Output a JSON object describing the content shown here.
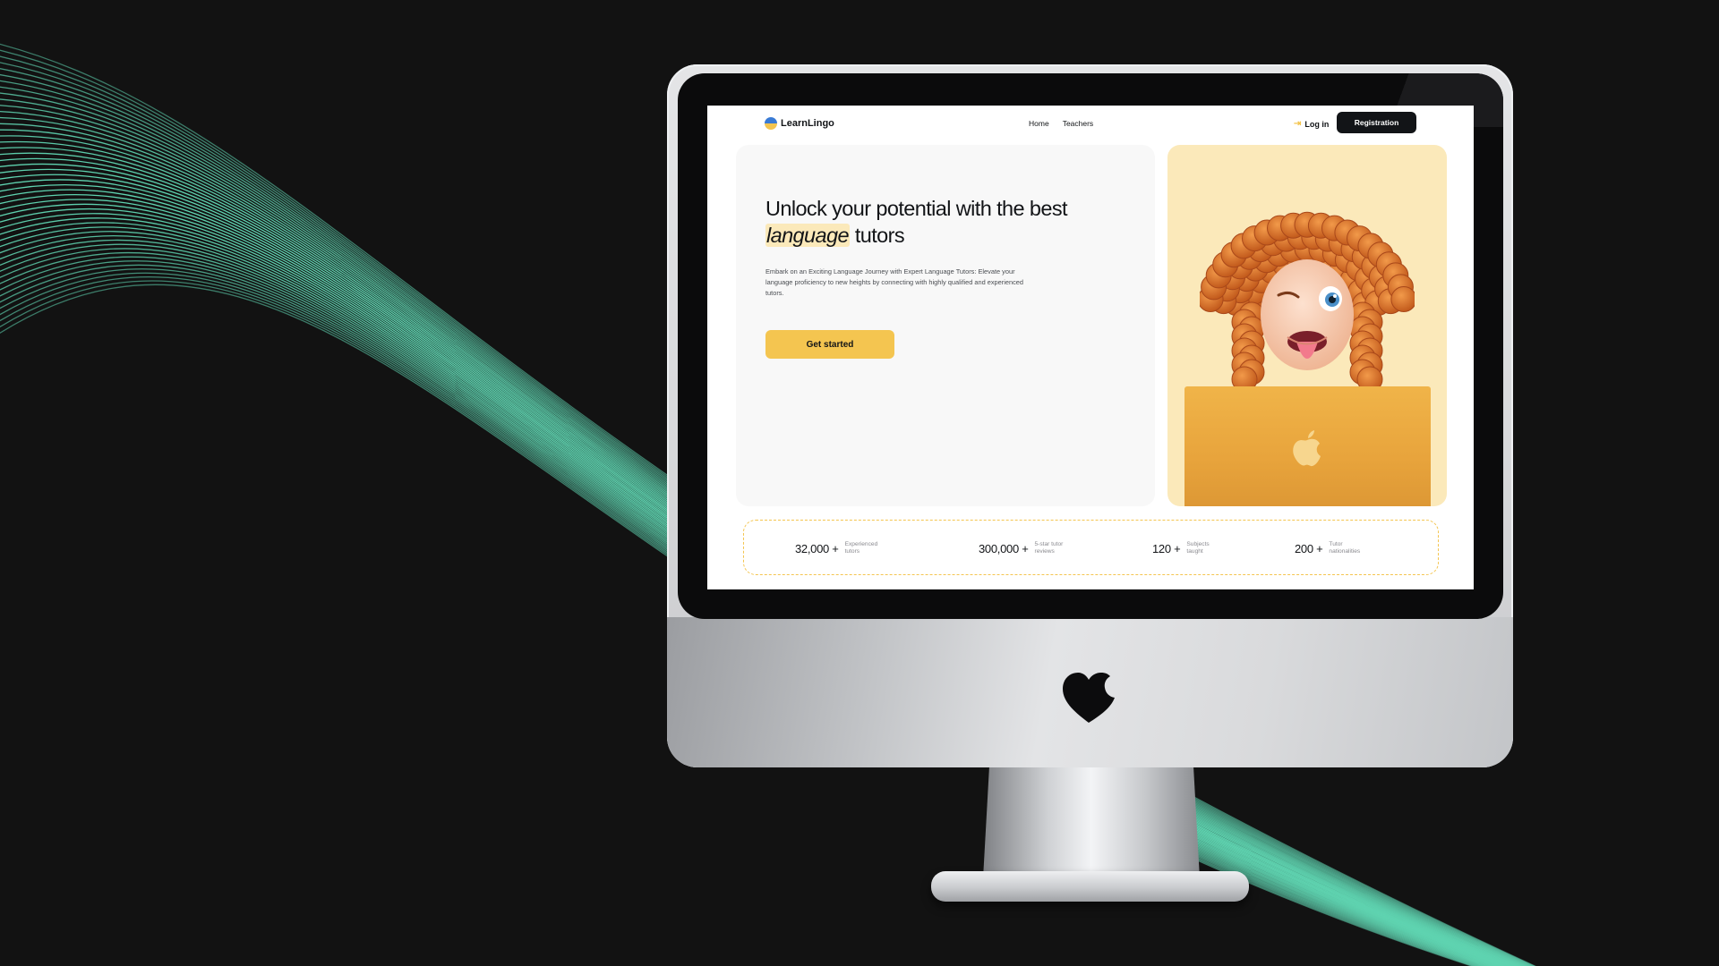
{
  "brand": {
    "name": "LearnLingo"
  },
  "nav": {
    "links": [
      "Home",
      "Teachers"
    ],
    "login_label": "Log in",
    "register_label": "Registration"
  },
  "hero": {
    "title_before": "Unlock your potential with the best ",
    "title_accent": "language",
    "title_after": " tutors",
    "description": "Embark on an Exciting Language Journey with Expert Language Tutors: Elevate your language proficiency to new heights by connecting with highly qualified and experienced tutors.",
    "cta_label": "Get started"
  },
  "stats": [
    {
      "value": "32,000 +",
      "label": "Experienced tutors"
    },
    {
      "value": "300,000 +",
      "label": "5-star tutor reviews"
    },
    {
      "value": "120 +",
      "label": "Subjects taught"
    },
    {
      "value": "200 +",
      "label": "Tutor nationalities"
    }
  ],
  "colors": {
    "background": "#121212",
    "wave": "#5fd3b0",
    "accent": "#f4c550",
    "accent_light": "#fbe9ba",
    "dark": "#121417"
  },
  "icons": {
    "login": "login-icon",
    "device_logo": "heart-icon",
    "laptop_logo": "apple-icon"
  }
}
